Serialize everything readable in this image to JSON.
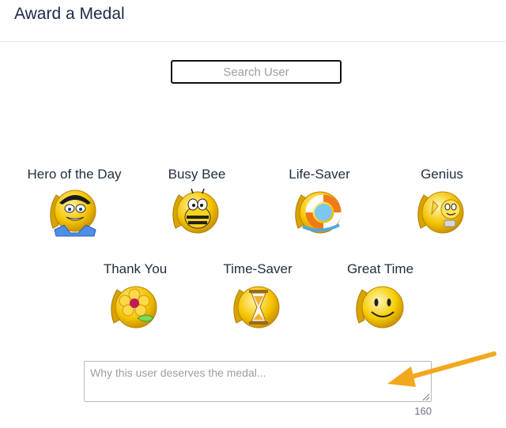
{
  "header": {
    "title": "Award a Medal"
  },
  "search": {
    "placeholder": "Search User"
  },
  "medals": [
    {
      "label": "Hero of the Day",
      "icon": "hero-medal-icon"
    },
    {
      "label": "Busy Bee",
      "icon": "bee-medal-icon"
    },
    {
      "label": "Life-Saver",
      "icon": "lifebuoy-medal-icon"
    },
    {
      "label": "Genius",
      "icon": "genius-medal-icon"
    },
    {
      "label": "Thank You",
      "icon": "flower-medal-icon"
    },
    {
      "label": "Time-Saver",
      "icon": "hourglass-medal-icon"
    },
    {
      "label": "Great Time",
      "icon": "smiley-medal-icon"
    }
  ],
  "reason": {
    "placeholder": "Why this user deserves the medal...",
    "counter": "160"
  },
  "colors": {
    "gold": "#e8b400",
    "arrow": "#f2a81d",
    "title": "#1c2b45"
  }
}
